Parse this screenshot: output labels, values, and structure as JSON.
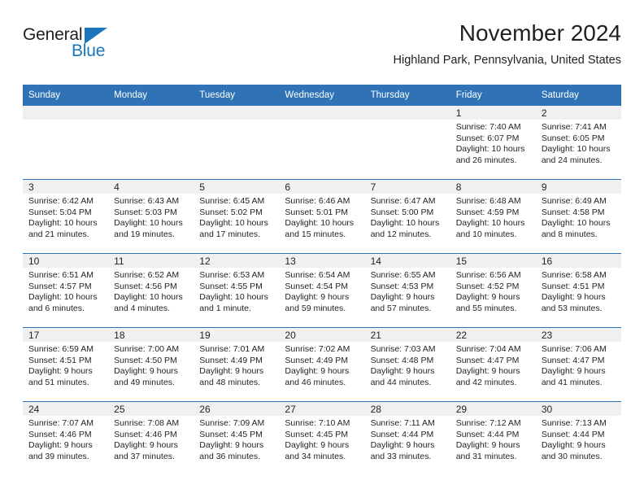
{
  "logo": {
    "word_top": "General",
    "word_bottom": "Blue",
    "triangle_icon": "triangle-icon",
    "brand_color": "#1b76bc"
  },
  "header": {
    "month_title": "November 2024",
    "location": "Highland Park, Pennsylvania, United States"
  },
  "theme": {
    "header_blue": "#2f72b6",
    "daynum_band": "#f0f0f0",
    "text": "#231f20"
  },
  "calendar": {
    "weekday_headers": [
      "Sunday",
      "Monday",
      "Tuesday",
      "Wednesday",
      "Thursday",
      "Friday",
      "Saturday"
    ],
    "weeks": [
      [
        {
          "day": "",
          "sunrise": "",
          "sunset": "",
          "daylight_line1": "",
          "daylight_line2": "",
          "empty": true
        },
        {
          "day": "",
          "sunrise": "",
          "sunset": "",
          "daylight_line1": "",
          "daylight_line2": "",
          "empty": true
        },
        {
          "day": "",
          "sunrise": "",
          "sunset": "",
          "daylight_line1": "",
          "daylight_line2": "",
          "empty": true
        },
        {
          "day": "",
          "sunrise": "",
          "sunset": "",
          "daylight_line1": "",
          "daylight_line2": "",
          "empty": true
        },
        {
          "day": "",
          "sunrise": "",
          "sunset": "",
          "daylight_line1": "",
          "daylight_line2": "",
          "empty": true
        },
        {
          "day": "1",
          "sunrise": "Sunrise: 7:40 AM",
          "sunset": "Sunset: 6:07 PM",
          "daylight_line1": "Daylight: 10 hours",
          "daylight_line2": "and 26 minutes.",
          "empty": false
        },
        {
          "day": "2",
          "sunrise": "Sunrise: 7:41 AM",
          "sunset": "Sunset: 6:05 PM",
          "daylight_line1": "Daylight: 10 hours",
          "daylight_line2": "and 24 minutes.",
          "empty": false
        }
      ],
      [
        {
          "day": "3",
          "sunrise": "Sunrise: 6:42 AM",
          "sunset": "Sunset: 5:04 PM",
          "daylight_line1": "Daylight: 10 hours",
          "daylight_line2": "and 21 minutes.",
          "empty": false
        },
        {
          "day": "4",
          "sunrise": "Sunrise: 6:43 AM",
          "sunset": "Sunset: 5:03 PM",
          "daylight_line1": "Daylight: 10 hours",
          "daylight_line2": "and 19 minutes.",
          "empty": false
        },
        {
          "day": "5",
          "sunrise": "Sunrise: 6:45 AM",
          "sunset": "Sunset: 5:02 PM",
          "daylight_line1": "Daylight: 10 hours",
          "daylight_line2": "and 17 minutes.",
          "empty": false
        },
        {
          "day": "6",
          "sunrise": "Sunrise: 6:46 AM",
          "sunset": "Sunset: 5:01 PM",
          "daylight_line1": "Daylight: 10 hours",
          "daylight_line2": "and 15 minutes.",
          "empty": false
        },
        {
          "day": "7",
          "sunrise": "Sunrise: 6:47 AM",
          "sunset": "Sunset: 5:00 PM",
          "daylight_line1": "Daylight: 10 hours",
          "daylight_line2": "and 12 minutes.",
          "empty": false
        },
        {
          "day": "8",
          "sunrise": "Sunrise: 6:48 AM",
          "sunset": "Sunset: 4:59 PM",
          "daylight_line1": "Daylight: 10 hours",
          "daylight_line2": "and 10 minutes.",
          "empty": false
        },
        {
          "day": "9",
          "sunrise": "Sunrise: 6:49 AM",
          "sunset": "Sunset: 4:58 PM",
          "daylight_line1": "Daylight: 10 hours",
          "daylight_line2": "and 8 minutes.",
          "empty": false
        }
      ],
      [
        {
          "day": "10",
          "sunrise": "Sunrise: 6:51 AM",
          "sunset": "Sunset: 4:57 PM",
          "daylight_line1": "Daylight: 10 hours",
          "daylight_line2": "and 6 minutes.",
          "empty": false
        },
        {
          "day": "11",
          "sunrise": "Sunrise: 6:52 AM",
          "sunset": "Sunset: 4:56 PM",
          "daylight_line1": "Daylight: 10 hours",
          "daylight_line2": "and 4 minutes.",
          "empty": false
        },
        {
          "day": "12",
          "sunrise": "Sunrise: 6:53 AM",
          "sunset": "Sunset: 4:55 PM",
          "daylight_line1": "Daylight: 10 hours",
          "daylight_line2": "and 1 minute.",
          "empty": false
        },
        {
          "day": "13",
          "sunrise": "Sunrise: 6:54 AM",
          "sunset": "Sunset: 4:54 PM",
          "daylight_line1": "Daylight: 9 hours",
          "daylight_line2": "and 59 minutes.",
          "empty": false
        },
        {
          "day": "14",
          "sunrise": "Sunrise: 6:55 AM",
          "sunset": "Sunset: 4:53 PM",
          "daylight_line1": "Daylight: 9 hours",
          "daylight_line2": "and 57 minutes.",
          "empty": false
        },
        {
          "day": "15",
          "sunrise": "Sunrise: 6:56 AM",
          "sunset": "Sunset: 4:52 PM",
          "daylight_line1": "Daylight: 9 hours",
          "daylight_line2": "and 55 minutes.",
          "empty": false
        },
        {
          "day": "16",
          "sunrise": "Sunrise: 6:58 AM",
          "sunset": "Sunset: 4:51 PM",
          "daylight_line1": "Daylight: 9 hours",
          "daylight_line2": "and 53 minutes.",
          "empty": false
        }
      ],
      [
        {
          "day": "17",
          "sunrise": "Sunrise: 6:59 AM",
          "sunset": "Sunset: 4:51 PM",
          "daylight_line1": "Daylight: 9 hours",
          "daylight_line2": "and 51 minutes.",
          "empty": false
        },
        {
          "day": "18",
          "sunrise": "Sunrise: 7:00 AM",
          "sunset": "Sunset: 4:50 PM",
          "daylight_line1": "Daylight: 9 hours",
          "daylight_line2": "and 49 minutes.",
          "empty": false
        },
        {
          "day": "19",
          "sunrise": "Sunrise: 7:01 AM",
          "sunset": "Sunset: 4:49 PM",
          "daylight_line1": "Daylight: 9 hours",
          "daylight_line2": "and 48 minutes.",
          "empty": false
        },
        {
          "day": "20",
          "sunrise": "Sunrise: 7:02 AM",
          "sunset": "Sunset: 4:49 PM",
          "daylight_line1": "Daylight: 9 hours",
          "daylight_line2": "and 46 minutes.",
          "empty": false
        },
        {
          "day": "21",
          "sunrise": "Sunrise: 7:03 AM",
          "sunset": "Sunset: 4:48 PM",
          "daylight_line1": "Daylight: 9 hours",
          "daylight_line2": "and 44 minutes.",
          "empty": false
        },
        {
          "day": "22",
          "sunrise": "Sunrise: 7:04 AM",
          "sunset": "Sunset: 4:47 PM",
          "daylight_line1": "Daylight: 9 hours",
          "daylight_line2": "and 42 minutes.",
          "empty": false
        },
        {
          "day": "23",
          "sunrise": "Sunrise: 7:06 AM",
          "sunset": "Sunset: 4:47 PM",
          "daylight_line1": "Daylight: 9 hours",
          "daylight_line2": "and 41 minutes.",
          "empty": false
        }
      ],
      [
        {
          "day": "24",
          "sunrise": "Sunrise: 7:07 AM",
          "sunset": "Sunset: 4:46 PM",
          "daylight_line1": "Daylight: 9 hours",
          "daylight_line2": "and 39 minutes.",
          "empty": false
        },
        {
          "day": "25",
          "sunrise": "Sunrise: 7:08 AM",
          "sunset": "Sunset: 4:46 PM",
          "daylight_line1": "Daylight: 9 hours",
          "daylight_line2": "and 37 minutes.",
          "empty": false
        },
        {
          "day": "26",
          "sunrise": "Sunrise: 7:09 AM",
          "sunset": "Sunset: 4:45 PM",
          "daylight_line1": "Daylight: 9 hours",
          "daylight_line2": "and 36 minutes.",
          "empty": false
        },
        {
          "day": "27",
          "sunrise": "Sunrise: 7:10 AM",
          "sunset": "Sunset: 4:45 PM",
          "daylight_line1": "Daylight: 9 hours",
          "daylight_line2": "and 34 minutes.",
          "empty": false
        },
        {
          "day": "28",
          "sunrise": "Sunrise: 7:11 AM",
          "sunset": "Sunset: 4:44 PM",
          "daylight_line1": "Daylight: 9 hours",
          "daylight_line2": "and 33 minutes.",
          "empty": false
        },
        {
          "day": "29",
          "sunrise": "Sunrise: 7:12 AM",
          "sunset": "Sunset: 4:44 PM",
          "daylight_line1": "Daylight: 9 hours",
          "daylight_line2": "and 31 minutes.",
          "empty": false
        },
        {
          "day": "30",
          "sunrise": "Sunrise: 7:13 AM",
          "sunset": "Sunset: 4:44 PM",
          "daylight_line1": "Daylight: 9 hours",
          "daylight_line2": "and 30 minutes.",
          "empty": false
        }
      ]
    ]
  }
}
